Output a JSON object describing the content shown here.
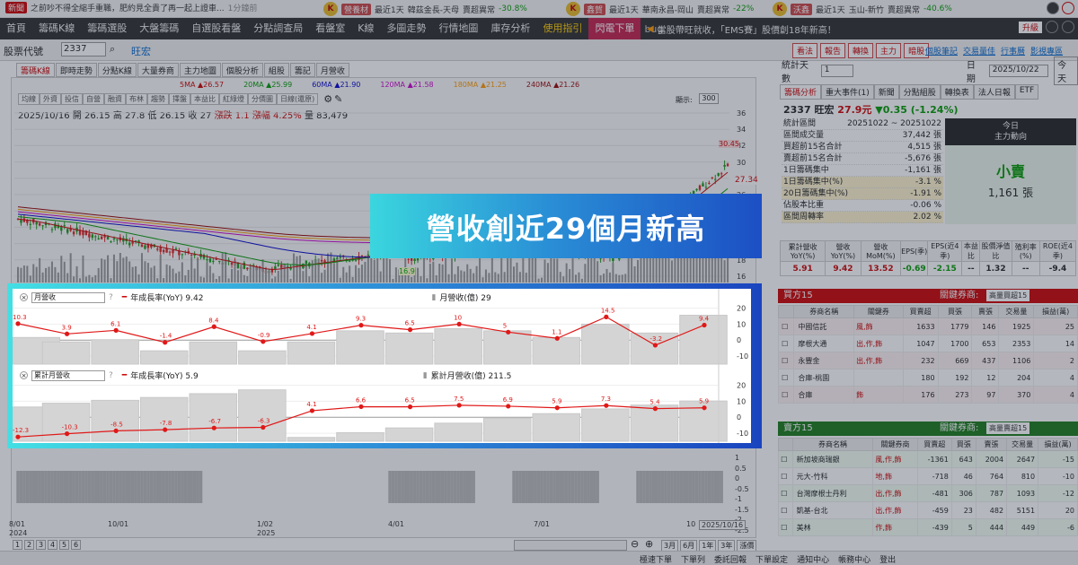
{
  "tickers": [
    {
      "tag": "新聞",
      "text": "之前吵不得全縮手重職，肥約見全貴了再一起上證車...",
      "time": "1分鐘前"
    },
    {
      "tag": "營養材",
      "label": "最近1天",
      "name": "韓茲金長-天母",
      "change": "賣超異常",
      "pct": "-30.8%"
    },
    {
      "tag": "鑫賀",
      "label": "最近1天",
      "name": "華南永昌-岡山",
      "change": "賣超異常",
      "pct": "-22%"
    },
    {
      "tag": "沃鑫",
      "label": "最近1天",
      "name": "玉山-新竹",
      "change": "賣超異常",
      "pct": "-40.6%"
    }
  ],
  "nav": {
    "items": [
      "首頁",
      "籌碼K線",
      "籌碼選股",
      "大盤籌碼",
      "自選股看盤",
      "分點調查局",
      "看盤室",
      "K線",
      "多圖走勢",
      "行情地圖",
      "庫存分析",
      "使用指引"
    ],
    "flash": "閃電下單",
    "search": "bug",
    "announcement": "當股帶旺就收，「EMS賽」股價創18年新高！",
    "upgrade": "升級"
  },
  "stockbar": {
    "label": "股票代號",
    "code": "2337",
    "name": "旺宏",
    "buttons": [
      "看法",
      "報告",
      "轉換",
      "主力",
      "暗股"
    ],
    "links": [
      "個股筆記",
      "交易量佳",
      "行事曆",
      "影視專區"
    ]
  },
  "chart_tabs": [
    "籌碼K線",
    "即時走勢",
    "分點K線",
    "大量券商",
    "主力地圖",
    "個股分析",
    "組股",
    "籌記",
    "月營收"
  ],
  "ma_legend": [
    "5MA ▲26.57",
    "20MA ▲25.99",
    "60MA ▲21.90",
    "120MA ▲21.58",
    "180MA ▲21.25",
    "240MA ▲21.26"
  ],
  "ma_colors": [
    "#c00",
    "#090",
    "#00c",
    "#c0c",
    "#f90",
    "#900"
  ],
  "chart_toolbar": [
    "均線",
    "外資",
    "投信",
    "自營",
    "融資",
    "布林",
    "趨勢",
    "擇盤",
    "本益比",
    "紅綠燈",
    "分價圖",
    "日線(還原)"
  ],
  "display": {
    "label": "顯示:",
    "value": "300"
  },
  "pricebar": {
    "date": "2025/10/16",
    "open": "開 26.15",
    "high": "高 27.8",
    "low": "低 26.15",
    "close": "收 27",
    "chg": "漲跌 1.1",
    "pct": "漲幅 4.25%",
    "vol": "量 83,479"
  },
  "price_ticks": [
    "36",
    "34",
    "32",
    "30",
    "28",
    "26",
    "24",
    "22",
    "20",
    "18",
    "16"
  ],
  "price_labels": {
    "last": "27.34",
    "peak": "30.45",
    "low": "16.9"
  },
  "x_labels": [
    {
      "t": "8/01",
      "y": "2024"
    },
    {
      "t": "10/01",
      "y": ""
    },
    {
      "t": "1/02",
      "y": "2025"
    },
    {
      "t": "4/01",
      "y": ""
    },
    {
      "t": "7/01",
      "y": ""
    },
    {
      "t": "10",
      "y": ""
    }
  ],
  "cursor_date": "2025/10/16",
  "lower_ticks": [
    "1",
    "0.5",
    "0",
    "-0.5",
    "-1",
    "-1.5",
    "-2",
    "-2.5"
  ],
  "pages": [
    "1",
    "2",
    "3",
    "4",
    "5",
    "6"
  ],
  "ranges": [
    "3月",
    "6月",
    "1年",
    "3年"
  ],
  "range_extra": "漲價",
  "banner": "營收創近29個月新高",
  "monthly": {
    "selector": "月營收",
    "yoy_label": "年成長率(YoY) 9.42",
    "bar_label": "月營收(億) 29",
    "yoy_values": [
      10.3,
      3.9,
      6.1,
      -1.4,
      8.4,
      -0.9,
      4.1,
      9.3,
      6.5,
      10,
      5,
      1.1,
      14.5,
      -3.2,
      9.4
    ],
    "bar_values": [
      24,
      23,
      23.5,
      21,
      23,
      21,
      23,
      25.5,
      25,
      26,
      25.5,
      24,
      27,
      25,
      29
    ],
    "y_ticks": [
      "20",
      "10",
      "0",
      "-10"
    ]
  },
  "cumulative": {
    "selector": "累計月營收",
    "yoy_label": "年成長率(YoY) 5.9",
    "bar_label": "累計月營收(億) 211.5",
    "yoy_values": [
      -12.3,
      -10.3,
      -8.5,
      -7.8,
      -6.7,
      -6.3,
      4.1,
      6.6,
      6.5,
      7.5,
      6.9,
      5.9,
      7.3,
      5.4,
      5.9
    ],
    "bar_values": [
      180,
      200,
      215,
      230,
      250,
      270,
      20,
      45,
      70,
      95,
      120,
      145,
      170,
      190,
      211.5
    ],
    "y_ticks": [
      "20",
      "10",
      "0",
      "-10"
    ]
  },
  "right": {
    "stat_days_label": "統計天數",
    "stat_days": "1",
    "date_label": "日期",
    "date": "2025/10/22",
    "today": "今天",
    "tabs": [
      "籌碼分析",
      "重大事件(1)",
      "新聞",
      "分點組股",
      "轉換表",
      "法人日報",
      "ETF"
    ],
    "stock": "2337 旺宏",
    "price": "27.9元",
    "change": "▼0.35 (-1.24%)",
    "stats": [
      {
        "k": "統計區間",
        "v": "20251022 ~ 20251022"
      },
      {
        "k": "區間成交量",
        "v": "37,442 張"
      },
      {
        "k": "買超前15名合計",
        "v": "4,515 張"
      },
      {
        "k": "賣超前15名合計",
        "v": "-5,676 張"
      },
      {
        "k": "1日籌碼集中",
        "v": "-1,161 張"
      },
      {
        "k": "1日籌碼集中(%)",
        "v": "-3.1 %"
      },
      {
        "k": "20日籌碼集中(%)",
        "v": "-1.91 %"
      },
      {
        "k": "佔股本比重",
        "v": "-0.06 %"
      },
      {
        "k": "區間周轉率",
        "v": "2.02 %"
      }
    ],
    "mainforce": {
      "title": "今日",
      "subtitle": "主力動向",
      "direction": "小賣",
      "volume": "1,161 張"
    },
    "fin_headers": [
      "累計營收YoY(%)",
      "營收YoY(%)",
      "營收MoM(%)",
      "EPS(季)",
      "EPS(近4季)",
      "本益比",
      "股價淨值比",
      "殖利率(%)",
      "ROE(近4季)"
    ],
    "fin_values": [
      "5.91",
      "9.42",
      "13.52",
      "-0.69",
      "-2.15",
      "--",
      "1.32",
      "--",
      "-9.4"
    ],
    "buy": {
      "title": "買方15",
      "filter": "關鍵券商:",
      "filter_val": "高量買超15",
      "headers": [
        "券商名稱",
        "關鍵券",
        "買賣超",
        "買張",
        "賣張",
        "交易量",
        "損益(萬)"
      ],
      "rows": [
        [
          "中國信託",
          "風,飾",
          "1633",
          "1779",
          "146",
          "1925",
          "25"
        ],
        [
          "摩根大通",
          "出,作,飾",
          "1047",
          "1700",
          "653",
          "2353",
          "14"
        ],
        [
          "永豐金",
          "出,作,飾",
          "232",
          "669",
          "437",
          "1106",
          "2"
        ],
        [
          "合庫-桃園",
          "",
          "180",
          "192",
          "12",
          "204",
          "4"
        ],
        [
          "合庫",
          "飾",
          "176",
          "273",
          "97",
          "370",
          "4"
        ]
      ]
    },
    "sell": {
      "title": "賣方15",
      "filter": "關鍵券商:",
      "filter_val": "高量賣超15",
      "headers": [
        "券商名稱",
        "關鍵券商",
        "買賣超",
        "買張",
        "賣張",
        "交易量",
        "損益(萬)"
      ],
      "rows": [
        [
          "新加坡商瑞銀",
          "風,作,飾",
          "-1361",
          "643",
          "2004",
          "2647",
          "-15"
        ],
        [
          "元大-竹科",
          "地,飾",
          "-718",
          "46",
          "764",
          "810",
          "-10"
        ],
        [
          "台灣摩根士丹利",
          "出,作,飾",
          "-481",
          "306",
          "787",
          "1093",
          "-12"
        ],
        [
          "凱基-台北",
          "出,作,飾",
          "-459",
          "23",
          "482",
          "5151",
          "20"
        ],
        [
          "美林",
          "作,飾",
          "-439",
          "5",
          "444",
          "449",
          "-6"
        ]
      ]
    }
  },
  "bottom_links": [
    "極速下單",
    "下單列",
    "委託回報",
    "下單設定",
    "通知中心",
    "帳務中心",
    "登出"
  ]
}
